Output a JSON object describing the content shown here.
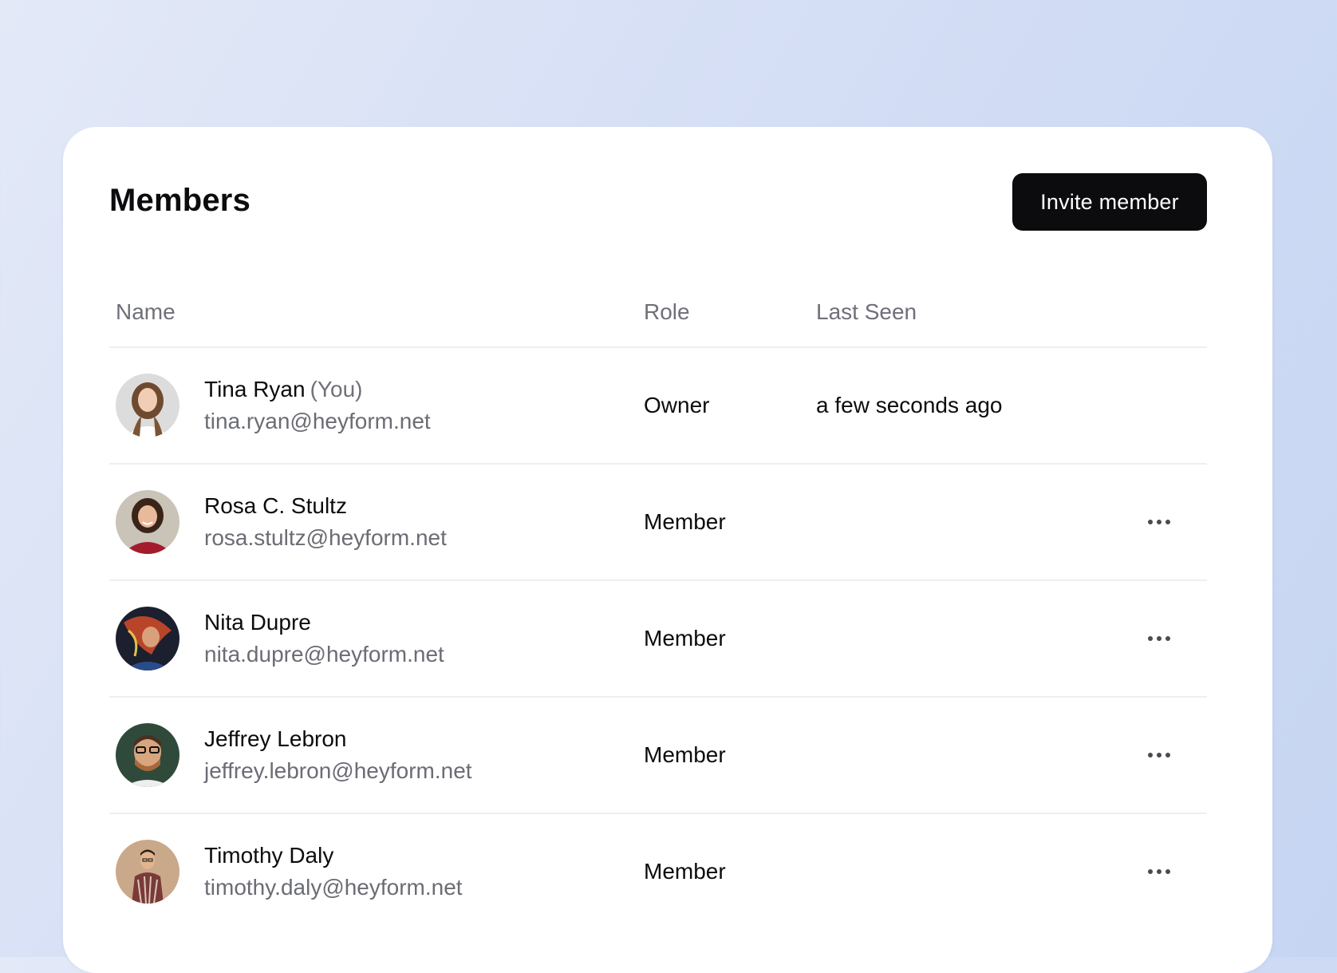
{
  "header": {
    "title": "Members",
    "invite_label": "Invite member"
  },
  "table": {
    "columns": [
      "Name",
      "Role",
      "Last Seen"
    ],
    "rows": [
      {
        "name": "Tina Ryan",
        "you_tag": "(You)",
        "email": "tina.ryan@heyform.net",
        "role": "Owner",
        "last_seen": "a few seconds ago",
        "avatar": "avatar-photo"
      },
      {
        "name": "Rosa C. Stultz",
        "email": "rosa.stultz@heyform.net",
        "role": "Member",
        "last_seen": "",
        "avatar": "avatar-photo",
        "more_icon": "more-horizontal-icon"
      },
      {
        "name": "Nita Dupre",
        "email": "nita.dupre@heyform.net",
        "role": "Member",
        "last_seen": "",
        "avatar": "avatar-photo",
        "more_icon": "more-horizontal-icon"
      },
      {
        "name": "Jeffrey Lebron",
        "email": "jeffrey.lebron@heyform.net",
        "role": "Member",
        "last_seen": "",
        "avatar": "avatar-photo",
        "more_icon": "more-horizontal-icon"
      },
      {
        "name": "Timothy Daly",
        "email": "timothy.daly@heyform.net",
        "role": "Member",
        "last_seen": "",
        "avatar": "avatar-photo",
        "more_icon": "more-horizontal-icon"
      }
    ]
  },
  "colors": {
    "background_start": "#e3e9f7",
    "background_end": "#c6d5f2",
    "button_bg": "#0c0c0e",
    "text_primary": "#0c0c0e",
    "text_secondary": "#6f7079",
    "divider": "#eeeff2"
  }
}
